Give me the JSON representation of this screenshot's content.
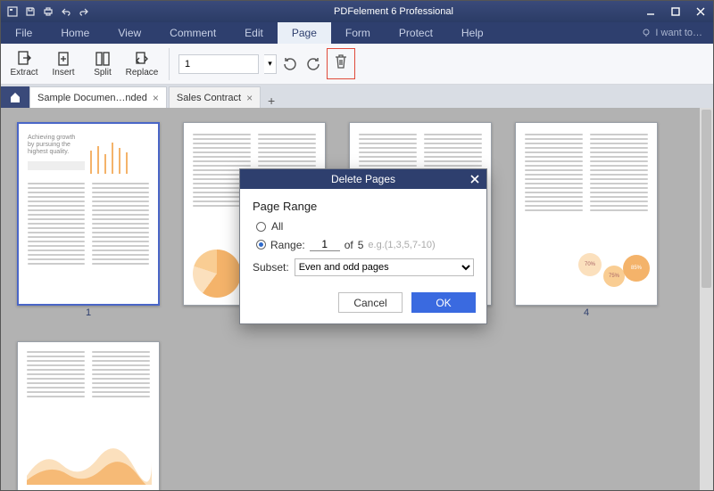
{
  "app": {
    "title": "PDFelement 6 Professional"
  },
  "menu": {
    "items": [
      "File",
      "Home",
      "View",
      "Comment",
      "Edit",
      "Page",
      "Form",
      "Protect",
      "Help"
    ],
    "active_index": 5,
    "i_want_to": "I want to…"
  },
  "ribbon": {
    "extract": "Extract",
    "insert": "Insert",
    "split": "Split",
    "replace": "Replace",
    "current_page": "1"
  },
  "tabs": {
    "items": [
      {
        "label": "Sample Documen…nded",
        "active": true
      },
      {
        "label": "Sales Contract",
        "active": false
      }
    ]
  },
  "thumbs": {
    "labels": [
      "1",
      "",
      "",
      "4",
      ""
    ]
  },
  "dialog": {
    "title": "Delete Pages",
    "section": "Page Range",
    "opt_all": "All",
    "opt_range": "Range:",
    "range_from": "1",
    "range_of": "of",
    "range_total": "5",
    "range_hint": "e.g.(1,3,5,7-10)",
    "subset_label": "Subset:",
    "subset_value": "Even and odd pages",
    "cancel": "Cancel",
    "ok": "OK"
  }
}
